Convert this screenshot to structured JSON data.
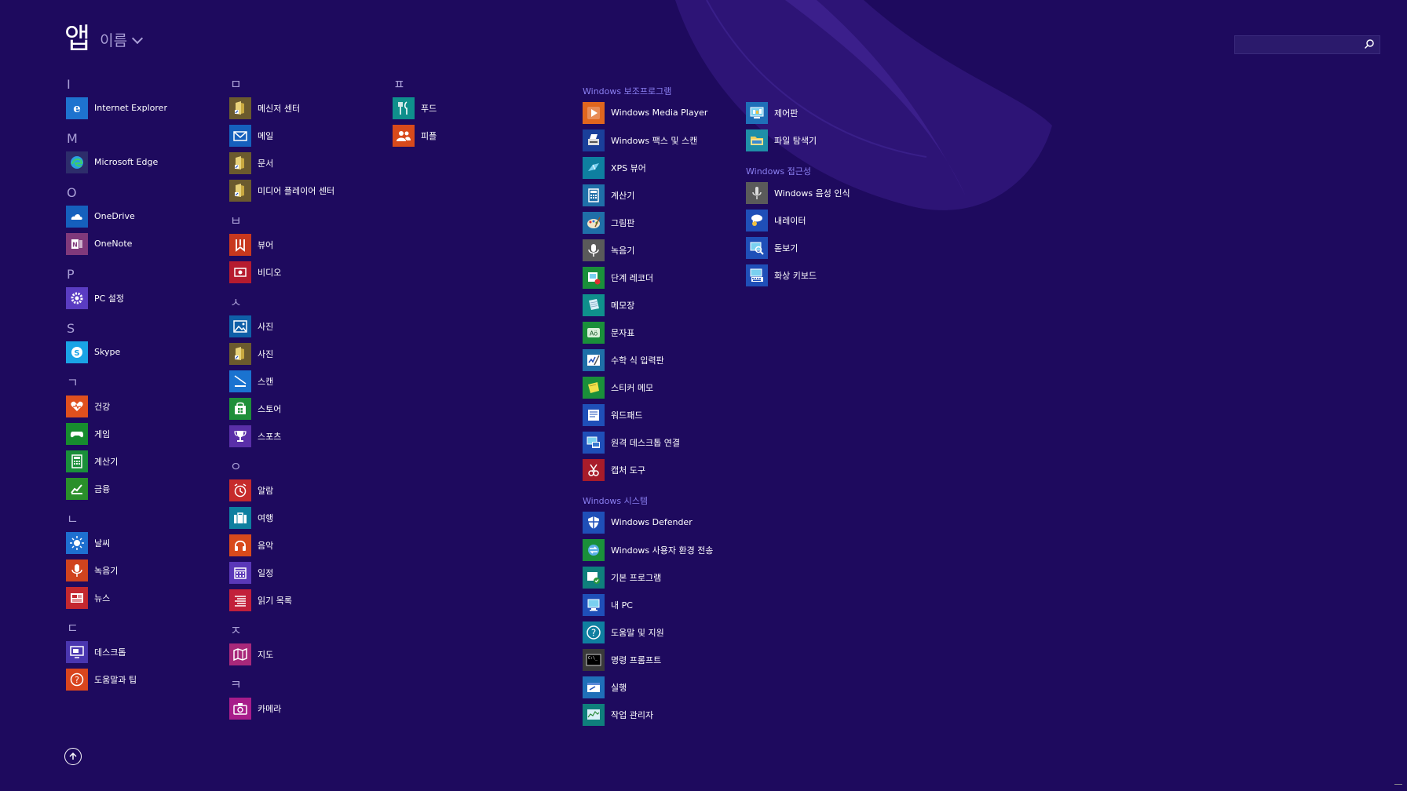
{
  "header": {
    "title": "앱",
    "sort_label": "이름"
  },
  "search": {
    "placeholder": ""
  },
  "columns": [
    {
      "sections": [
        {
          "letter": "I",
          "items": [
            {
              "label": "Internet Explorer",
              "icon": "internet-explorer-icon",
              "color": "#1e73cf"
            }
          ]
        },
        {
          "letter": "M",
          "items": [
            {
              "label": "Microsoft Edge",
              "icon": "microsoft-edge-icon",
              "color": "#2d2d6b"
            }
          ]
        },
        {
          "letter": "O",
          "items": [
            {
              "label": "OneDrive",
              "icon": "onedrive-icon",
              "color": "#1560bd"
            },
            {
              "label": "OneNote",
              "icon": "onenote-icon",
              "color": "#80397b"
            }
          ]
        },
        {
          "letter": "P",
          "items": [
            {
              "label": "PC 설정",
              "icon": "gear-icon",
              "color": "#5a3cc2"
            }
          ]
        },
        {
          "letter": "S",
          "items": [
            {
              "label": "Skype",
              "icon": "skype-icon",
              "color": "#1aa3e6"
            }
          ]
        },
        {
          "letter": "ㄱ",
          "items": [
            {
              "label": "건강",
              "icon": "health-icon",
              "color": "#e0501e"
            },
            {
              "label": "게임",
              "icon": "game-controller-icon",
              "color": "#178c2e"
            },
            {
              "label": "계산기",
              "icon": "calculator-icon",
              "color": "#1a8f3a"
            },
            {
              "label": "금융",
              "icon": "finance-chart-icon",
              "color": "#2a8f2a"
            }
          ]
        },
        {
          "letter": "ㄴ",
          "items": [
            {
              "label": "날씨",
              "icon": "weather-sun-icon",
              "color": "#1e6fd0"
            },
            {
              "label": "녹음기",
              "icon": "microphone-icon",
              "color": "#d0431e"
            },
            {
              "label": "뉴스",
              "icon": "news-icon",
              "color": "#c4282f"
            }
          ]
        },
        {
          "letter": "ㄷ",
          "items": [
            {
              "label": "데스크톱",
              "icon": "desktop-icon",
              "color": "#4a36b0"
            },
            {
              "label": "도움말과 팁",
              "icon": "help-tips-icon",
              "color": "#d9451e"
            }
          ]
        }
      ]
    },
    {
      "sections": [
        {
          "letter": "ㅁ",
          "items": [
            {
              "label": "메신저 센터",
              "icon": "folder-shortcut-icon",
              "color": "#6b5a2e"
            },
            {
              "label": "메일",
              "icon": "mail-icon",
              "color": "#1560bd"
            },
            {
              "label": "문서",
              "icon": "folder-shortcut-icon",
              "color": "#6b5a2e"
            },
            {
              "label": "미디어 플레이어 센터",
              "icon": "folder-shortcut-icon",
              "color": "#6b5a2e"
            }
          ]
        },
        {
          "letter": "ㅂ",
          "items": [
            {
              "label": "뷰어",
              "icon": "reader-icon",
              "color": "#c8381e"
            },
            {
              "label": "비디오",
              "icon": "video-icon",
              "color": "#b61b2f"
            }
          ]
        },
        {
          "letter": "ㅅ",
          "items": [
            {
              "label": "사진",
              "icon": "photos-icon",
              "color": "#0f5fa8"
            },
            {
              "label": "사진",
              "icon": "folder-shortcut-icon",
              "color": "#6b5a2e"
            },
            {
              "label": "스캔",
              "icon": "scan-icon",
              "color": "#1a73d0"
            },
            {
              "label": "스토어",
              "icon": "store-icon",
              "color": "#1f8f3a"
            },
            {
              "label": "스포츠",
              "icon": "trophy-icon",
              "color": "#5a2fa8"
            }
          ]
        },
        {
          "letter": "ㅇ",
          "items": [
            {
              "label": "알람",
              "icon": "alarm-clock-icon",
              "color": "#c62b2b"
            },
            {
              "label": "여행",
              "icon": "suitcase-icon",
              "color": "#0e7fa0"
            },
            {
              "label": "음악",
              "icon": "headphones-icon",
              "color": "#d84a1b"
            },
            {
              "label": "일정",
              "icon": "calendar-icon",
              "color": "#5a38b8"
            },
            {
              "label": "읽기 목록",
              "icon": "reading-list-icon",
              "color": "#c2203a"
            }
          ]
        },
        {
          "letter": "ㅈ",
          "items": [
            {
              "label": "지도",
              "icon": "map-icon",
              "color": "#a8287a"
            }
          ]
        },
        {
          "letter": "ㅋ",
          "items": [
            {
              "label": "카메라",
              "icon": "camera-icon",
              "color": "#a81c8a"
            }
          ]
        }
      ]
    },
    {
      "sections": [
        {
          "letter": "ㅍ",
          "items": [
            {
              "label": "푸드",
              "icon": "food-icon",
              "color": "#0f8f8c"
            },
            {
              "label": "피플",
              "icon": "people-icon",
              "color": "#d84a1b"
            }
          ]
        }
      ]
    },
    {
      "sections": [
        {
          "group": "Windows 보조프로그램",
          "items": [
            {
              "label": "Windows Media Player",
              "icon": "media-player-icon",
              "color": "#e0661e"
            },
            {
              "label": "Windows 팩스 및 스캔",
              "icon": "fax-scan-icon",
              "color": "#1a3f9a"
            },
            {
              "label": "XPS 뷰어",
              "icon": "xps-viewer-icon",
              "color": "#0e7fa0"
            },
            {
              "label": "계산기",
              "icon": "calculator-icon",
              "color": "#1f6fa8"
            },
            {
              "label": "그림판",
              "icon": "paint-icon",
              "color": "#1f6fa8"
            },
            {
              "label": "녹음기",
              "icon": "microphone-icon",
              "color": "#5a5a5a"
            },
            {
              "label": "단계 레코더",
              "icon": "steps-recorder-icon",
              "color": "#1a8f3a"
            },
            {
              "label": "메모장",
              "icon": "notepad-icon",
              "color": "#0f8f8c"
            },
            {
              "label": "문자표",
              "icon": "character-map-icon",
              "color": "#1a8f3a"
            },
            {
              "label": "수학 식 입력판",
              "icon": "math-input-icon",
              "color": "#1f6fa8"
            },
            {
              "label": "스티커 메모",
              "icon": "sticky-notes-icon",
              "color": "#1a8f3a"
            },
            {
              "label": "워드패드",
              "icon": "wordpad-icon",
              "color": "#1f4fb8"
            },
            {
              "label": "원격 데스크톱 연결",
              "icon": "remote-desktop-icon",
              "color": "#1f4fb8"
            },
            {
              "label": "캡처 도구",
              "icon": "snipping-tool-icon",
              "color": "#a81c2a"
            }
          ]
        },
        {
          "group": "Windows 시스템",
          "items": [
            {
              "label": "Windows Defender",
              "icon": "shield-icon",
              "color": "#1f4fb8"
            },
            {
              "label": "Windows 사용자 환경 전송",
              "icon": "easy-transfer-icon",
              "color": "#1a8f3a"
            },
            {
              "label": "기본 프로그램",
              "icon": "default-programs-icon",
              "color": "#0f7f7c"
            },
            {
              "label": "내 PC",
              "icon": "computer-icon",
              "color": "#1f4fb8"
            },
            {
              "label": "도움말 및 지원",
              "icon": "help-icon",
              "color": "#0f7fa0"
            },
            {
              "label": "명령 프롬프트",
              "icon": "command-prompt-icon",
              "color": "#3a3a3a"
            },
            {
              "label": "실행",
              "icon": "run-icon",
              "color": "#1f6fb8"
            },
            {
              "label": "작업 관리자",
              "icon": "task-manager-icon",
              "color": "#0f7f7c"
            }
          ]
        }
      ]
    },
    {
      "sections": [
        {
          "group": "",
          "items": [
            {
              "label": "제어판",
              "icon": "control-panel-icon",
              "color": "#1f6fb8"
            },
            {
              "label": "파일 탐색기",
              "icon": "file-explorer-icon",
              "color": "#1f8fa8"
            }
          ]
        },
        {
          "group": "Windows 접근성",
          "items": [
            {
              "label": "Windows 음성 인식",
              "icon": "speech-recognition-icon",
              "color": "#5a5a5a"
            },
            {
              "label": "내레이터",
              "icon": "narrator-icon",
              "color": "#1f4fb8"
            },
            {
              "label": "돋보기",
              "icon": "magnifier-icon",
              "color": "#1f4fb8"
            },
            {
              "label": "화상 키보드",
              "icon": "on-screen-keyboard-icon",
              "color": "#1f4fb8"
            }
          ]
        }
      ]
    }
  ]
}
